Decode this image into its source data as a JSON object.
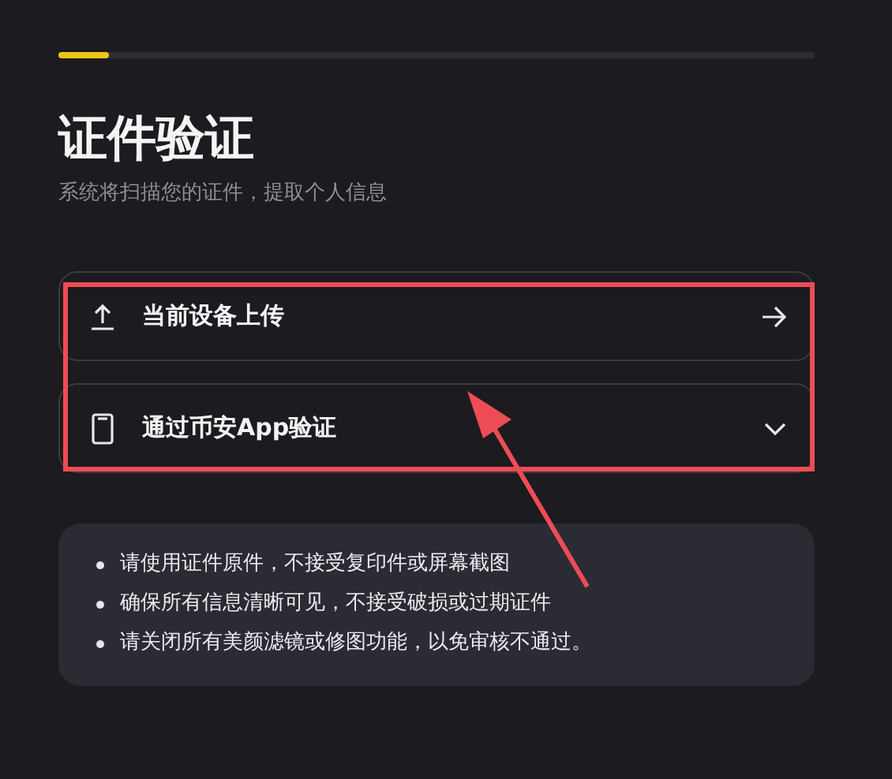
{
  "progress": {
    "level": 0.067
  },
  "title": "证件验证",
  "subtitle": "系统将扫描您的证件，提取个人信息",
  "options": [
    {
      "kind": "upload",
      "label": "当前设备上传",
      "expandable": false
    },
    {
      "kind": "phone",
      "label": "通过币安App验证",
      "expandable": true
    }
  ],
  "notes": [
    "请使用证件原件，不接受复印件或屏幕截图",
    "确保所有信息清晰可见，不接受破损或过期证件",
    "请关闭所有美颜滤镜或修图功能，以免审核不通过。"
  ]
}
